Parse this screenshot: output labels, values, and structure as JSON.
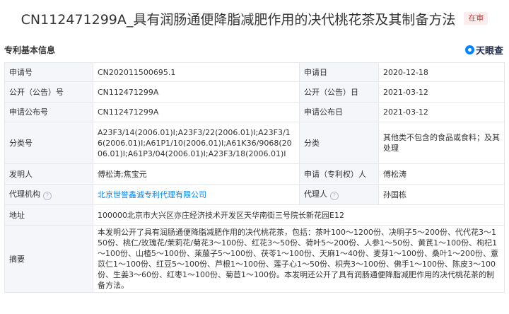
{
  "header": {
    "title": "CN112471299A_具有润肠通便降脂减肥作用的决代桃花茶及其制备方法",
    "status": "在审"
  },
  "section": {
    "title": "专利基本信息",
    "brand": "天眼查"
  },
  "fields": {
    "application_no_label": "申请号",
    "application_no": "CN202011500695.1",
    "application_date_label": "申请日",
    "application_date": "2020-12-18",
    "publication_no_label": "公开（公告）号",
    "publication_no": "CN112471299A",
    "publication_date_label": "公开（公告）日",
    "publication_date": "2021-03-12",
    "app_pub_no_label": "申请公布号",
    "app_pub_no": "CN112471299A",
    "app_pub_date_label": "申请公布日",
    "app_pub_date": "2021-03-12",
    "ipc_label": "分类号",
    "ipc": "A23F3/14(2006.01)I;A23F3/22(2006.01)I;A23F3/16(2006.01)I;A61P1/10(2006.01)I;A61K36/9068(2006.01)I;A61P3/04(2006.01)I;A23F3/18(2006.01)I",
    "category_label": "分类",
    "category": "其他类不包含的食品或食料；及其处理",
    "inventor_label": "发明人",
    "inventor": "傅松涛;焦宝元",
    "applicant_label": "申请（专利权）人",
    "applicant": "傅松涛",
    "agency_label": "代理机构",
    "agency": "北京世誉鑫诚专利代理有限公司",
    "agent_label": "代理人",
    "agent": "孙国栋",
    "address_label": "地址",
    "address": "100000北京市大兴区亦庄经济技术开发区天华南街三号院长新花园E12",
    "abstract_label": "摘要",
    "abstract": "本发明公开了具有润肠通便降脂减肥作用的决代桃花茶，包括：茶叶100～1200份、决明子5～200份、代代花3～150份、桃仁/玫瑰花/茉莉花/菊花3～100份、红花3～50份、荷叶5～200份、人参1～50份、黄芪1～100份、枸杞1～100份、山楂5～100份、莱菔子5～100份、茯苓1～100份、天麻1～40份、麦芽1～100份、桑叶1～200份、薏苡仁1～100份、红豆5～100份、芦根1～100份、莲子心1～50份、枳壳3～100份、佛手1～100份、陈皮3～100份、生姜3～60份、红枣1～100份、菊苣1～100份。本发明还公开了具有润肠通便降脂减肥作用的决代桃花茶的制备方法。"
  }
}
